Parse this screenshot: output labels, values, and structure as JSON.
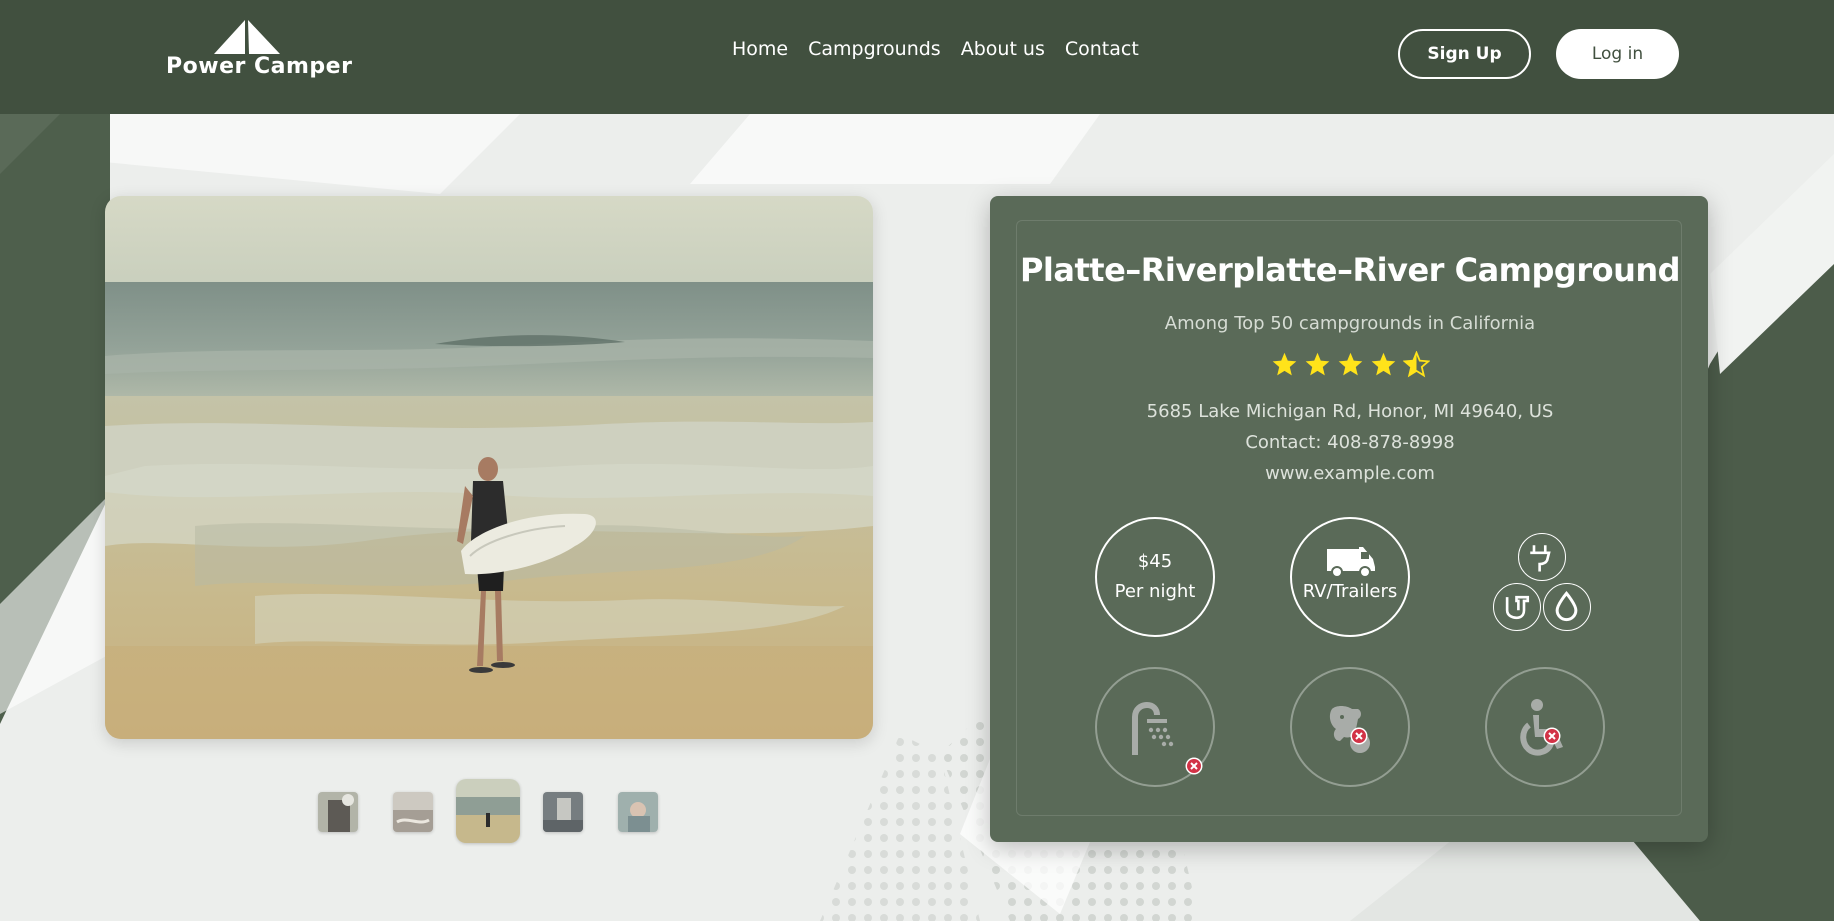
{
  "header": {
    "logo_text": "Power Camper",
    "nav": [
      "Home",
      "Campgrounds",
      "About us",
      "Contact"
    ],
    "signup_label": "Sign Up",
    "login_label": "Log in"
  },
  "gallery": {
    "thumbnail_count": 5,
    "active_thumbnail": 3
  },
  "campground": {
    "name": "Platte–Riverplatte–River Campground",
    "subtitle": "Among Top 50 campgrounds in California",
    "rating": 4.5,
    "rating_max": 5,
    "address": "5685 Lake Michigan Rd, Honor, MI 49640, US",
    "contact": "Contact: 408-878-8998",
    "website": "www.example.com",
    "price": "$45",
    "price_unit": "Per night",
    "vehicle_type": "RV/Trailers",
    "hookups": [
      "electric-icon",
      "sewer-icon",
      "water-icon"
    ],
    "unavailable_amenities": [
      "shower-icon",
      "pets-icon",
      "wheelchair-icon"
    ]
  },
  "colors": {
    "header_bg": "#41503f",
    "card_bg": "#5a6a58",
    "star": "#ffe31a",
    "unavailable_badge": "#d23246"
  }
}
